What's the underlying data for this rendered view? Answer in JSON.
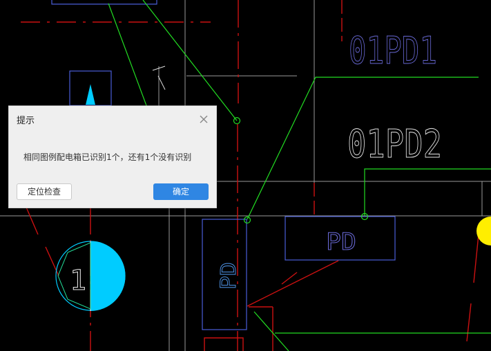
{
  "drawing": {
    "labels": {
      "panel_code_1": "01PD1",
      "panel_code_2": "01PD2",
      "box_label_horizontal": "PD",
      "box_label_vertical": "PD",
      "circle_number": "1"
    },
    "colors": {
      "background": "#000000",
      "dash_red": "#cc1111",
      "grid_white": "#9a9a9a",
      "leader_green": "#22dd22",
      "box_blue": "#4a5ed8",
      "label_purple": "#6a6ad8",
      "cyan_fill": "#00ccff",
      "yellow_marker": "#ffee00"
    }
  },
  "dialog": {
    "title": "提示",
    "message": "相同图例配电箱已识别1个，还有1个没有识别",
    "locate_button": "定位检查",
    "ok_button": "确定",
    "close_icon": "close-icon"
  }
}
